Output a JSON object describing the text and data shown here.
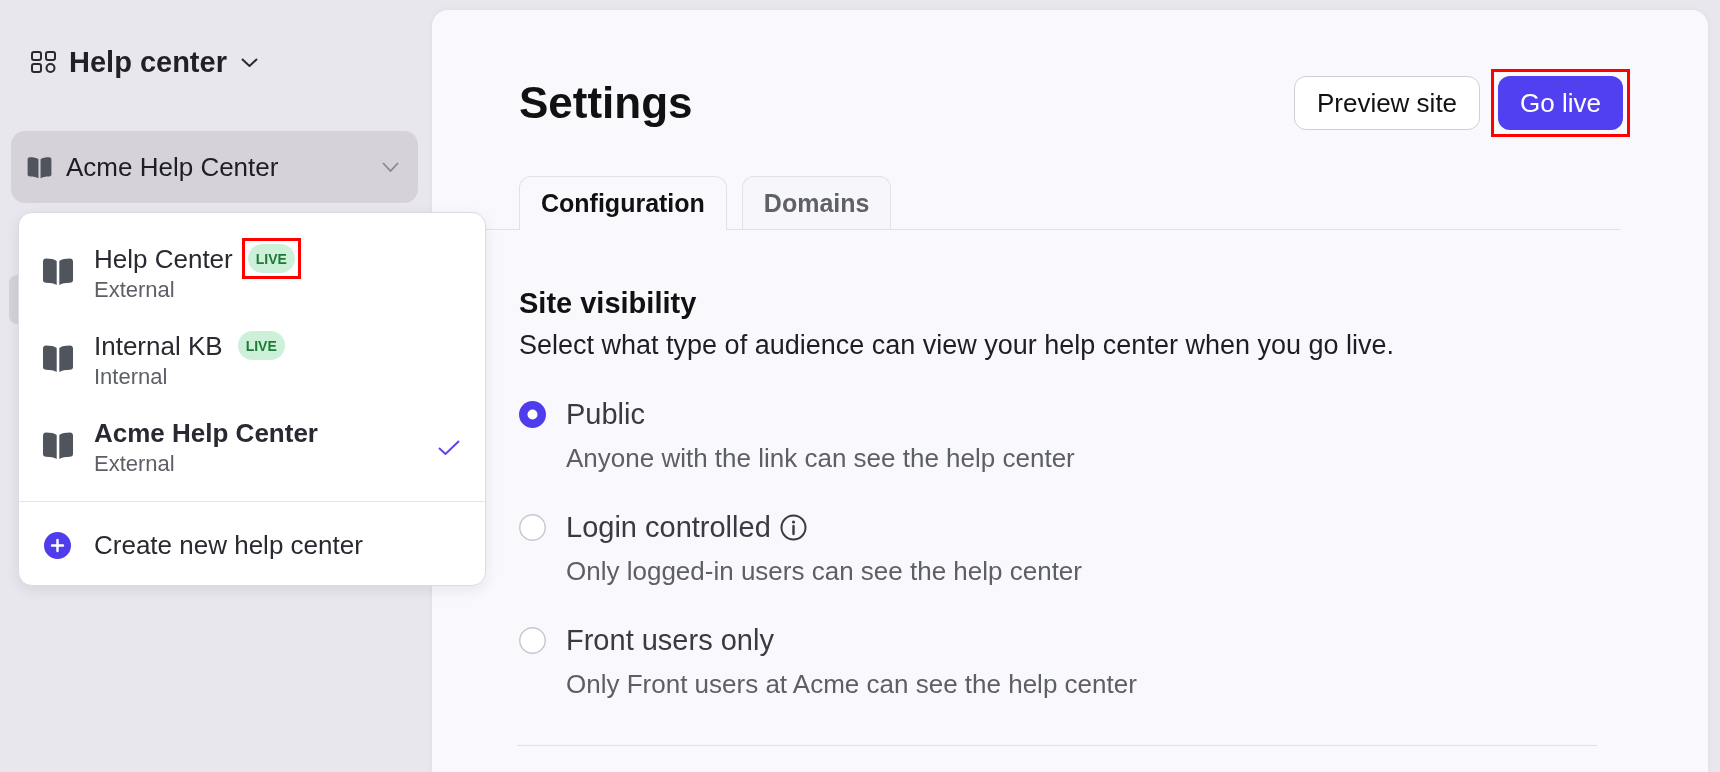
{
  "sidebar": {
    "title": "Help center",
    "selector": {
      "label": "Acme Help Center"
    }
  },
  "menu": {
    "items": [
      {
        "title": "Help Center",
        "subtitle": "External",
        "badge": {
          "label": "LIVE",
          "highlighted": true
        },
        "selected": false
      },
      {
        "title": "Internal KB",
        "subtitle": "Internal",
        "badge": {
          "label": "LIVE",
          "highlighted": false
        },
        "selected": false
      },
      {
        "title": "Acme Help Center",
        "subtitle": "External",
        "selected": true
      }
    ],
    "create": {
      "label": "Create new help center"
    }
  },
  "page": {
    "title": "Settings",
    "buttons": [
      {
        "label": "Preview site",
        "kind": "secondary",
        "highlighted": false
      },
      {
        "label": "Go live",
        "kind": "primary",
        "highlighted": true
      }
    ]
  },
  "tabs": [
    {
      "label": "Configuration",
      "selected": true
    },
    {
      "label": "Domains",
      "selected": false
    }
  ],
  "site_visibility": {
    "title": "Site visibility",
    "description": "Select what type of audience can view your help center when you go live.",
    "options": [
      {
        "label": "Public",
        "description": "Anyone with the link can see the help center",
        "selected": true,
        "info": false
      },
      {
        "label": "Login controlled",
        "description": "Only logged-in users can see the help center",
        "selected": false,
        "info": true
      },
      {
        "label": "Front users only",
        "description": "Only Front users at Acme can see the help center",
        "selected": false,
        "info": false
      }
    ]
  }
}
